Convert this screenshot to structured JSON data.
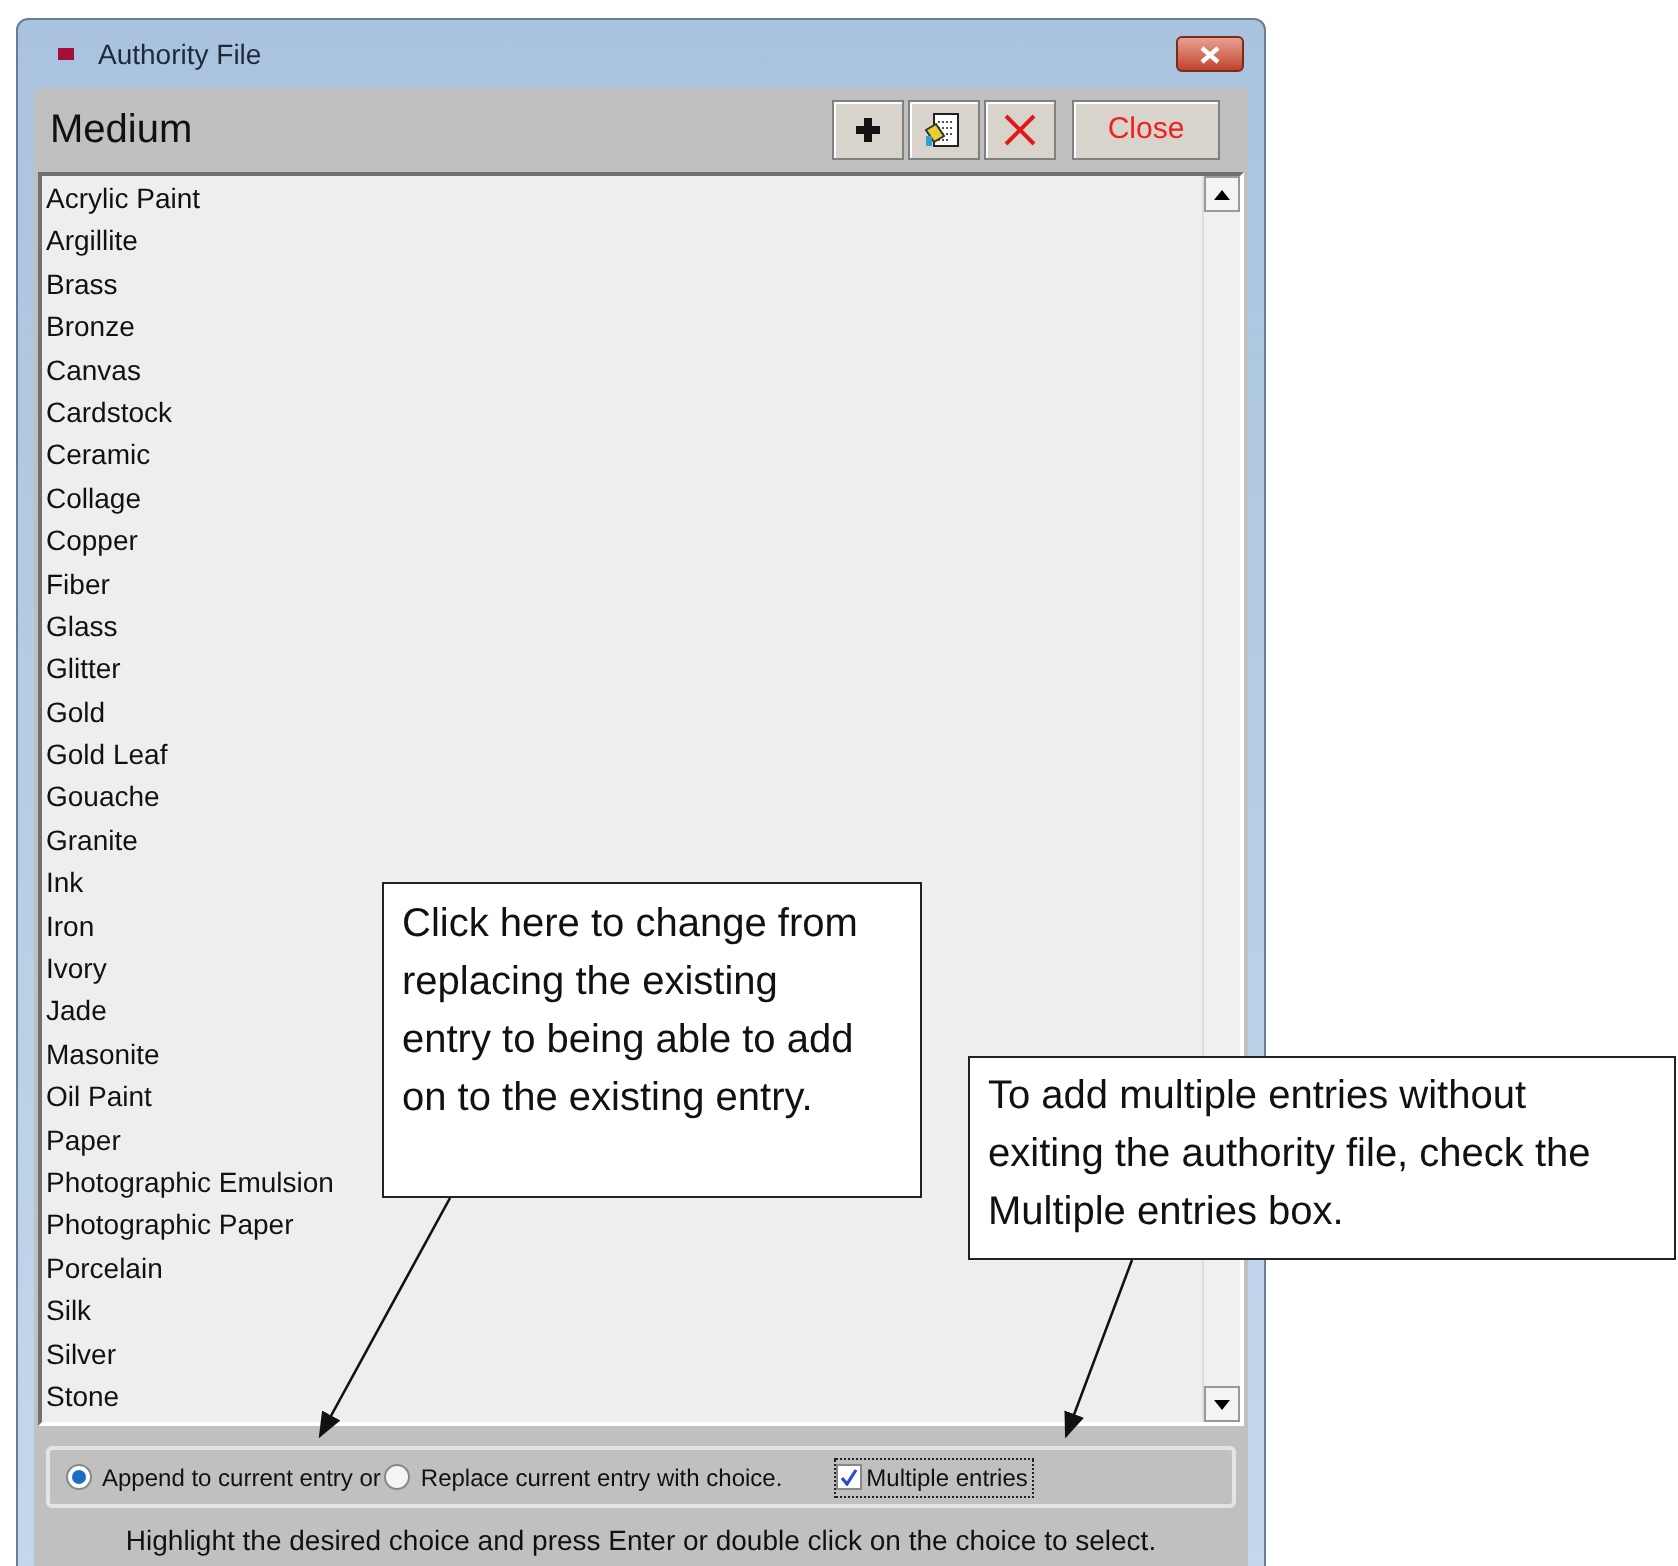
{
  "window": {
    "title": "Authority File"
  },
  "header": {
    "title": "Medium",
    "close_label": "Close"
  },
  "list": {
    "items": [
      "Acrylic Paint",
      "Argillite",
      "Brass",
      "Bronze",
      "Canvas",
      "Cardstock",
      "Ceramic",
      "Collage",
      "Copper",
      "Fiber",
      "Glass",
      "Glitter",
      "Gold",
      "Gold Leaf",
      "Gouache",
      "Granite",
      "Ink",
      "Iron",
      "Ivory",
      "Jade",
      "Masonite",
      "Oil Paint",
      "Paper",
      "Photographic Emulsion",
      "Photographic Paper",
      "Porcelain",
      "Silk",
      "Silver",
      "Stone"
    ]
  },
  "options": [
    {
      "label": "Append to current entry or",
      "selected": true
    },
    {
      "label": "Replace current entry with choice.",
      "selected": false
    }
  ],
  "multiple_entries": {
    "label": "Multiple entries",
    "checked": true
  },
  "hint": "Highlight the desired choice and press Enter or double click on the choice to select.",
  "callouts": [
    {
      "text": "Click here to change from replacing the existing entry to being able to add on to the existing entry."
    },
    {
      "text": "To add multiple entries without exiting the authority file, check the Multiple entries box."
    }
  ]
}
